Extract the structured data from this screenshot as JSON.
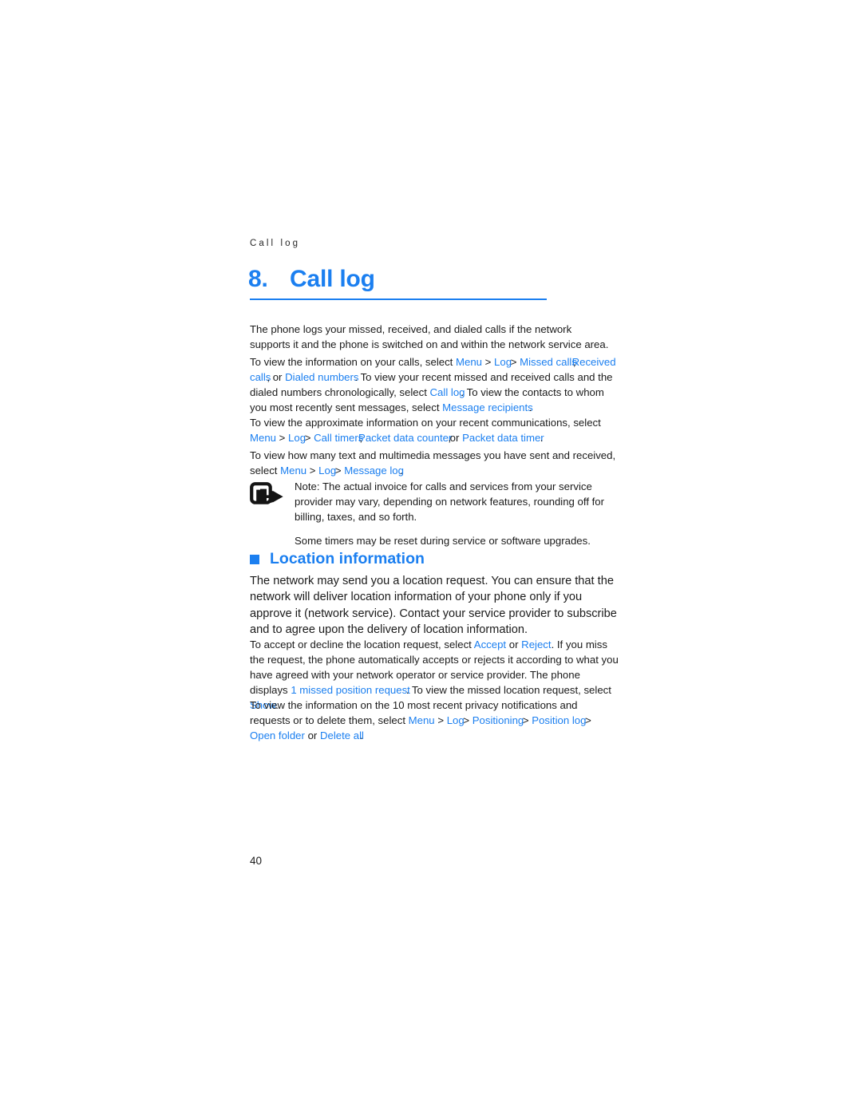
{
  "document": {
    "running_head": "Call log",
    "page_number": "40",
    "accent_color": "#1b7ff0",
    "body_color": "#1a1a1a"
  },
  "chapter": {
    "number": "8.",
    "title": "Call log"
  },
  "intro": {
    "line1": "The phone logs your missed, received, and dialed calls if the network supports it",
    "line2": "and the phone is switched on and within the network service area."
  },
  "para_view_calls": {
    "seg1": "To view the information on your calls, select ",
    "ui_menu": "Menu",
    "sep1": " > ",
    "ui_log": "Log",
    "sep2": " > ",
    "ui_missed_calls": "Missed calls",
    "comma1": ",",
    "ui_received_calls": "Received calls",
    "comma2": ",",
    "seg2": " or ",
    "ui_dialed_numbers": "Dialed numbers",
    "period1": ".",
    "seg3": " To view your recent missed and received calls and the dialed numbers chronologically, select ",
    "ui_call_log": "Call log",
    "period2": ".",
    "seg4": " To view the contacts to whom you most recently sent messages, select ",
    "ui_message_recipients": "Message recipients",
    "period3": "."
  },
  "para_approx_info": {
    "seg1": "To view the approximate information on your recent communications, select ",
    "ui_menu": "Menu",
    "sep1": " > ",
    "ui_log": "Log",
    "sep2": " > ",
    "ui_call_timers": "Call timers",
    "comma1": ",",
    "ui_packet_data_counter": "Packet data counter",
    "comma2": ",",
    "seg2": " or ",
    "ui_packet_data_timer": "Packet data timer",
    "period1": "."
  },
  "para_message_log": {
    "seg1": "To view how many text and multimedia messages you have sent and received, select ",
    "ui_menu": "Menu",
    "sep1": " > ",
    "ui_log": "Log",
    "sep2": " > ",
    "ui_message_log": "Message log",
    "period1": "."
  },
  "note": {
    "icon_name": "note-arrow-icon",
    "text": "Note: The actual invoice for calls and services from your service provider may vary, depending on network features, rounding off for billing, taxes, and so forth.",
    "text2": "Some timers may be reset during service or software upgrades."
  },
  "section_location": {
    "heading": "Location information",
    "intro": "The network may send you a location request. You can ensure that the network will deliver location information of your phone only if you approve it (network service). Contact your service provider to subscribe and to agree upon the delivery of location information."
  },
  "para_accept_reject": {
    "seg1": "To accept or decline the location request, select ",
    "ui_accept": "Accept",
    "seg2": " or ",
    "ui_reject": "Reject",
    "period1": ".",
    "seg3": " If you miss the request, the phone automatically accepts or rejects it according to what you have agreed with your network operator or service provider. The phone displays ",
    "ui_missed_request": "1 missed position request",
    "period2": ".",
    "seg4": " To view the missed location request, select ",
    "ui_show": "Show",
    "period3": "."
  },
  "para_privacy": {
    "seg1": "To view the information on the 10 most recent privacy notifications and requests or to delete them, select ",
    "ui_menu": "Menu",
    "sep1": " > ",
    "ui_log": "Log",
    "sep2": " > ",
    "ui_positioning": "Positioning",
    "sep3": " > ",
    "ui_position_log": "Position log",
    "sep4": " > ",
    "ui_open_folder": "Open folder",
    "seg2": " or ",
    "ui_delete_all": "Delete all",
    "period1": "."
  }
}
